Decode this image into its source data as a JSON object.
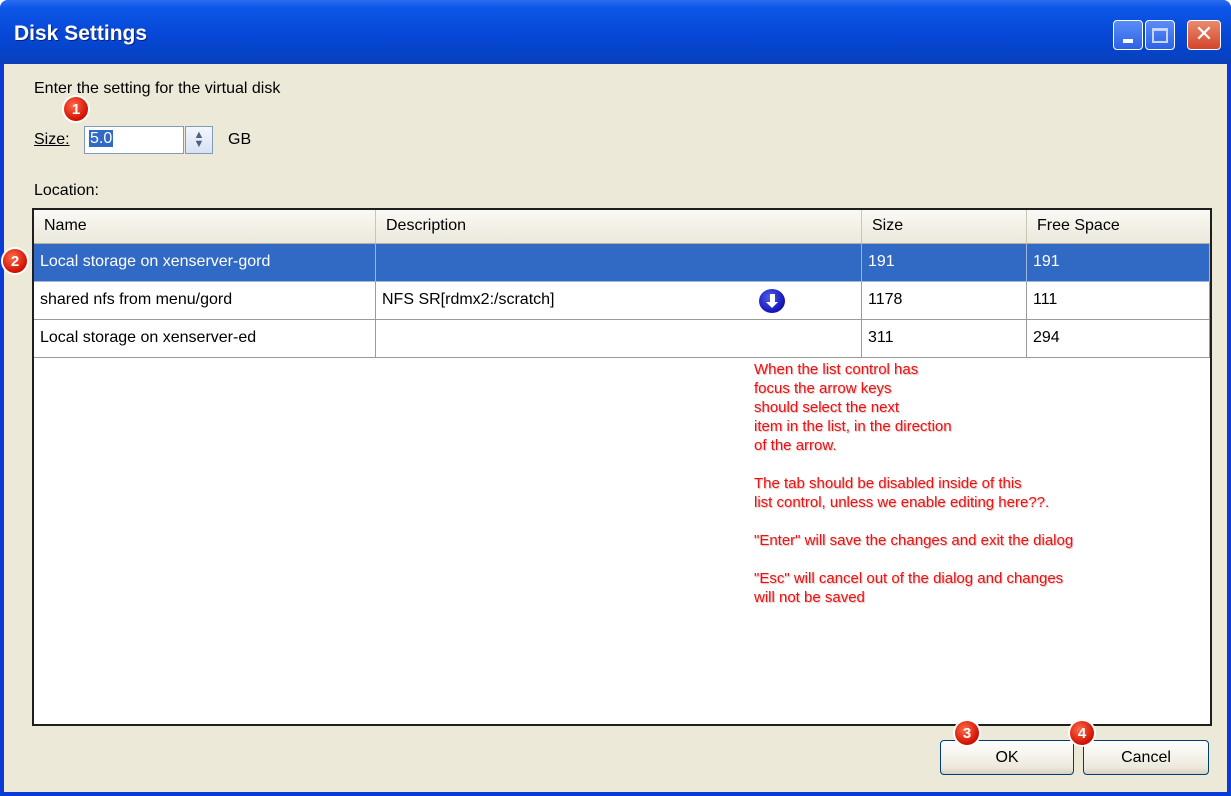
{
  "window": {
    "title": "Disk Settings",
    "close_glyph": "✕"
  },
  "form": {
    "prompt": "Enter the setting for the virtual disk",
    "size_label": "Size:",
    "size_value": "5.0",
    "size_unit": "GB",
    "location_label": "Location:"
  },
  "table": {
    "headers": [
      "Name",
      "Description",
      "Size",
      "Free Space"
    ],
    "rows": [
      {
        "name": "Local storage on xenserver-gord",
        "description": "",
        "size": "191",
        "free": "191",
        "selected": true
      },
      {
        "name": "shared nfs from menu/gord",
        "description": "NFS SR[rdmx2:/scratch]",
        "size": "1178",
        "free": "111",
        "selected": false
      },
      {
        "name": "Local storage on xenserver-ed",
        "description": "",
        "size": "311",
        "free": "294",
        "selected": false
      }
    ]
  },
  "annotation": {
    "text": "When the list control has\nfocus the arrow keys\nshould select the next\nitem in the list, in the direction\nof the arrow.\n\nThe tab should be disabled inside of this\nlist control, unless we enable editing here??.\n\n\"Enter\" will save the changes and exit the dialog\n\n\"Esc\" will cancel out of the dialog and changes\nwill not be saved"
  },
  "badges": {
    "b1": "1",
    "b2": "2",
    "b3": "3",
    "b4": "4"
  },
  "buttons": {
    "ok": "OK",
    "cancel": "Cancel"
  },
  "colors": {
    "selection": "#316ac5",
    "titlebar": "#0647d6",
    "annotation": "#ee1111",
    "badge": "#d10f00"
  }
}
